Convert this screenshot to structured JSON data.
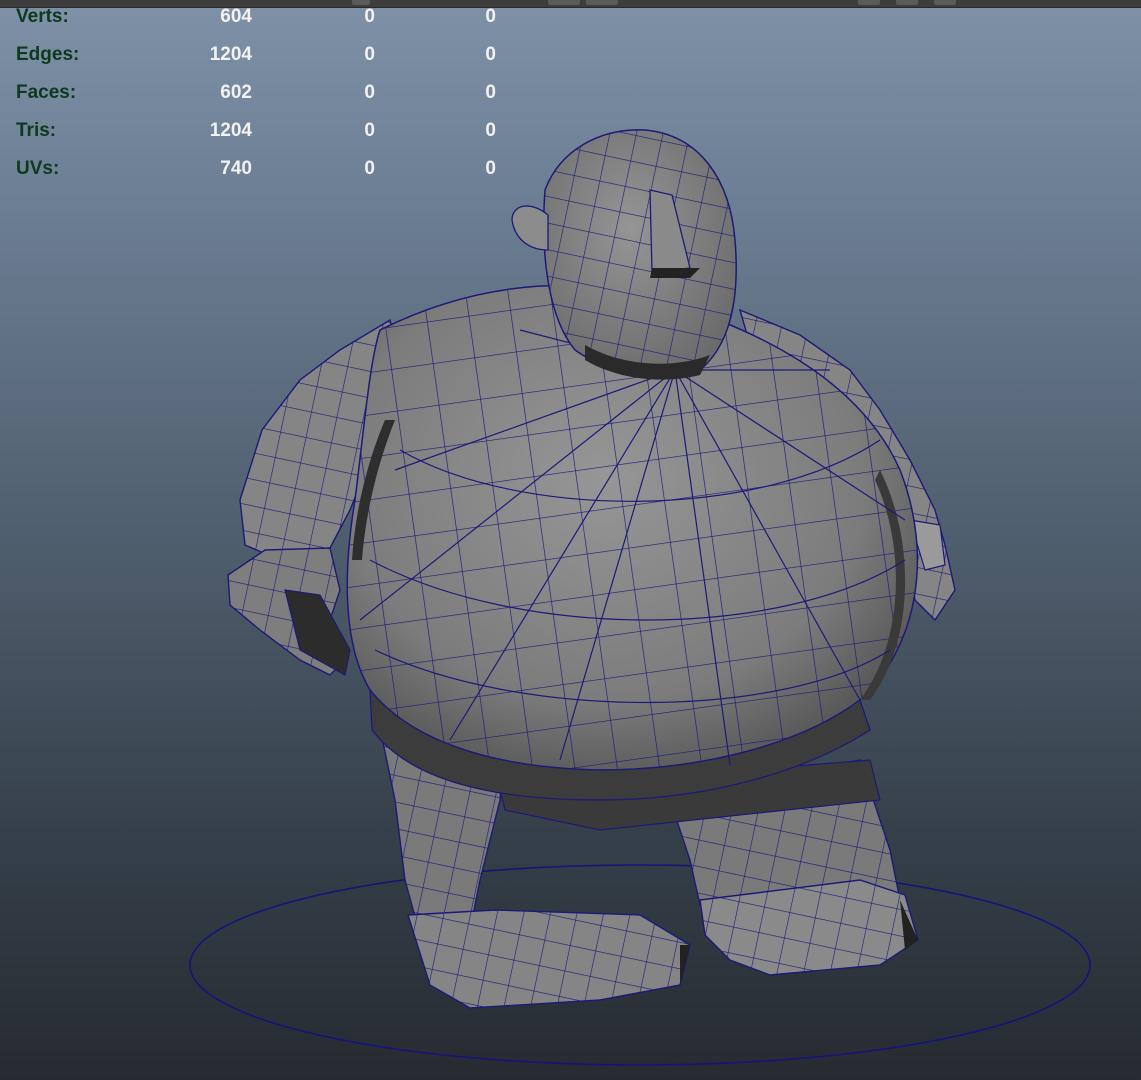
{
  "hud": {
    "rows": [
      {
        "label": "Verts:",
        "c1": "604",
        "c2": "0",
        "c3": "0"
      },
      {
        "label": "Edges:",
        "c1": "1204",
        "c2": "0",
        "c3": "0"
      },
      {
        "label": "Faces:",
        "c1": "602",
        "c2": "0",
        "c3": "0"
      },
      {
        "label": "Tris:",
        "c1": "1204",
        "c2": "0",
        "c3": "0"
      },
      {
        "label": "UVs:",
        "c1": "740",
        "c2": "0",
        "c3": "0"
      }
    ]
  },
  "colors": {
    "label": "#0d3a1e",
    "value": "#f2f2f2",
    "wire": "#1c1a78",
    "mesh_light": "#8a8a8a",
    "mesh_mid": "#6e6e6e",
    "mesh_dark": "#333333",
    "ground_circle": "#16147a"
  }
}
